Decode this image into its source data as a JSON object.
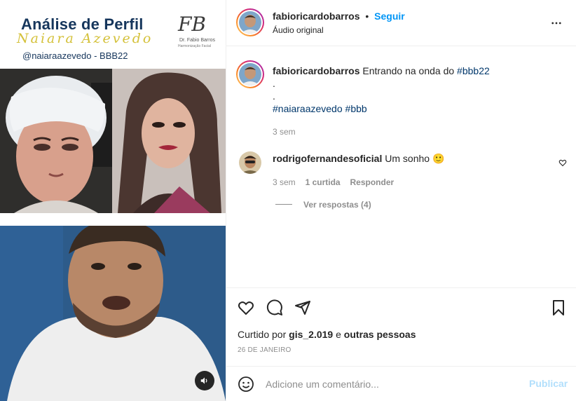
{
  "media": {
    "title": "Análise de Perfil",
    "script_name": "Naiara Azevedo",
    "handle": "@naiaraazevedo - BBB22",
    "logo_monogram": "FB",
    "logo_name": "Dr. Fabio Barros",
    "logo_sub": "Harmonização Facial",
    "sound_icon": "volume-icon"
  },
  "post": {
    "author": "fabioricardobarros",
    "separator": "•",
    "follow_label": "Seguir",
    "audio_label": "Áudio original",
    "more_icon": "more-horizontal-icon"
  },
  "caption": {
    "username": "fabioricardobarros",
    "text": "Entrando na onda do",
    "hashtag_inline": "#bbb22",
    "dot1": ".",
    "dot2": ".",
    "hashtag1": "#naiaraazevedo",
    "hashtag2": "#bbb",
    "time": "3 sem"
  },
  "comment": {
    "username": "rodrigofernandesoficial",
    "text": "Um sonho 🙂",
    "time": "3 sem",
    "likes": "1 curtida",
    "reply_label": "Responder",
    "view_replies": "Ver respostas (4)"
  },
  "actions": {
    "like_icon": "heart-icon",
    "comment_icon": "comment-icon",
    "share_icon": "share-icon",
    "save_icon": "bookmark-icon"
  },
  "likes": {
    "prefix": "Curtido por",
    "user": "gis_2.019",
    "middle": "e",
    "others": "outras pessoas"
  },
  "date": "26 DE JANEIRO",
  "comment_box": {
    "placeholder": "Adicione um comentário...",
    "publish_label": "Publicar"
  },
  "colors": {
    "accent": "#0095f6",
    "hashtag": "#00376b",
    "muted": "#8e8e8e",
    "publish_disabled": "#b2dffc",
    "title_navy": "#16365c",
    "script_gold": "#d4c13a"
  }
}
